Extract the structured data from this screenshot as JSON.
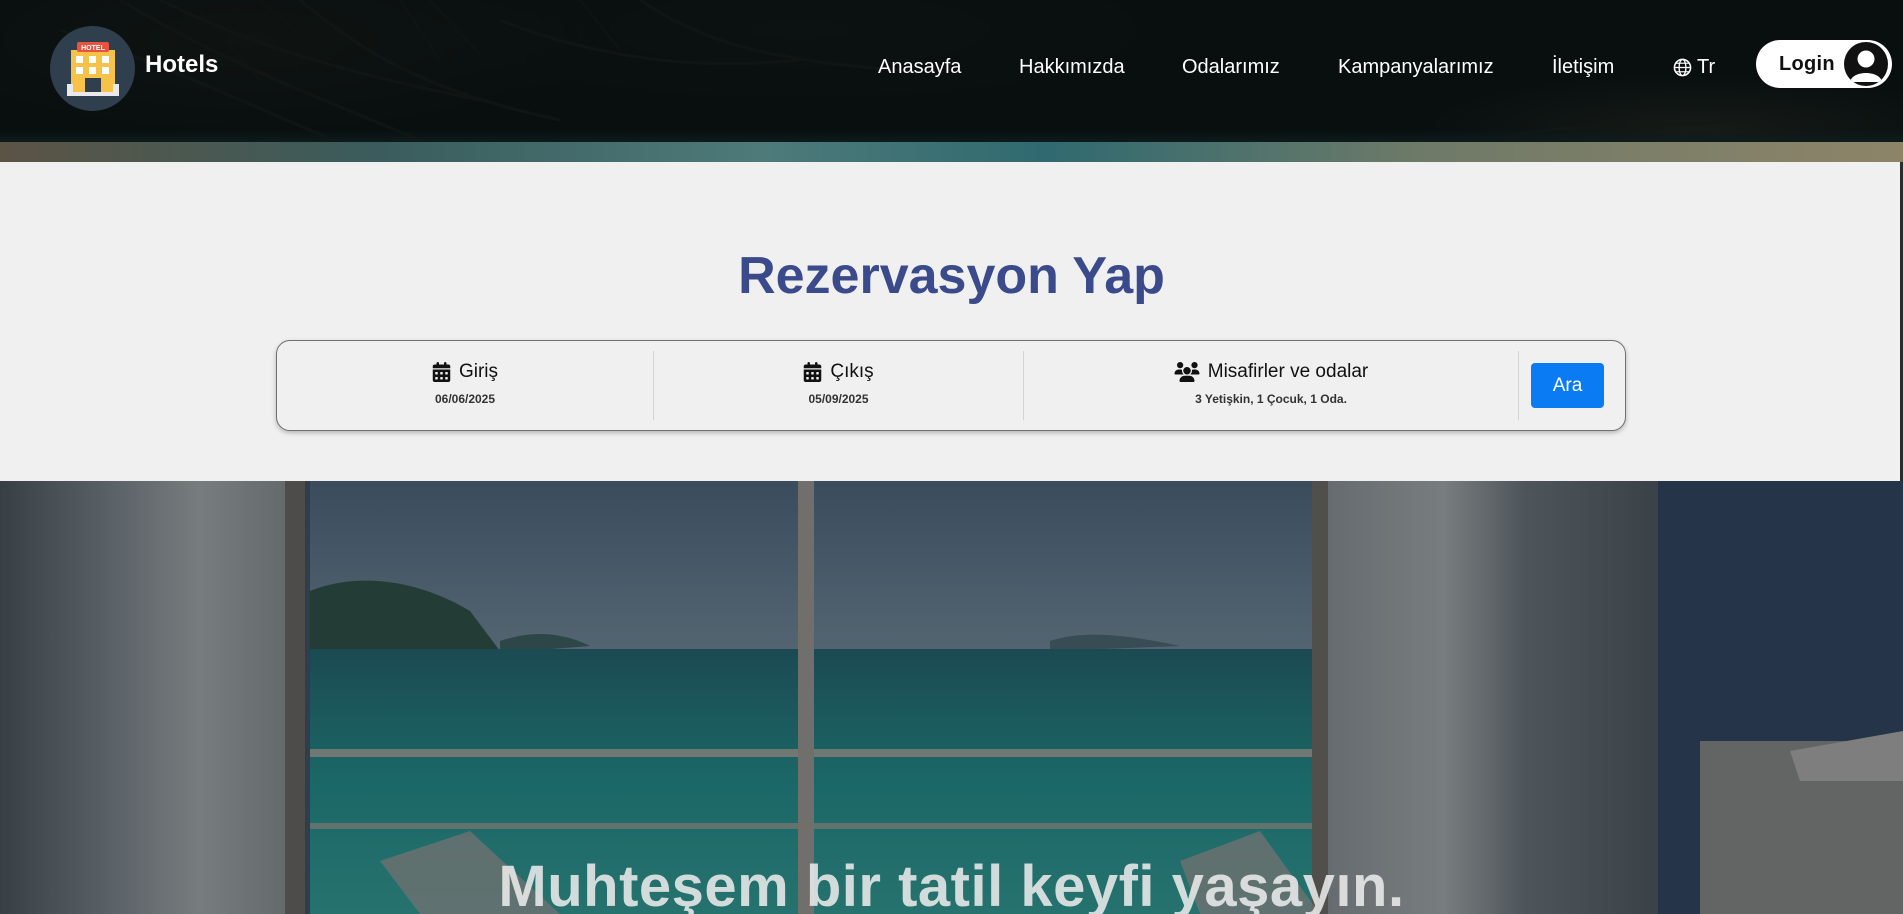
{
  "header": {
    "brand": "Hotels",
    "logo_sign": "HOTEL",
    "nav": [
      {
        "label": "Anasayfa"
      },
      {
        "label": "Hakkımızda"
      },
      {
        "label": "Odalarımız"
      },
      {
        "label": "Kampanyalarımız"
      },
      {
        "label": "İletişim"
      }
    ],
    "language": "Tr",
    "login_label": "Login"
  },
  "reservation": {
    "title": "Rezervasyon Yap",
    "checkin": {
      "label": "Giriş",
      "value": "06/06/2025",
      "icon": "calendar-icon"
    },
    "checkout": {
      "label": "Çıkış",
      "value": "05/09/2025",
      "icon": "calendar-icon"
    },
    "guests": {
      "label": "Misafirler ve odalar",
      "value": "3 Yetişkin, 1 Çocuk, 1 Oda.",
      "icon": "users-icon"
    },
    "search_label": "Ara"
  },
  "hero": {
    "headline": "Muhteşem bir tatil keyfi yaşayın."
  },
  "colors": {
    "title": "#3a4a8a",
    "search_button": "#0a7bf2",
    "logo_circle": "#2f3f4e"
  }
}
